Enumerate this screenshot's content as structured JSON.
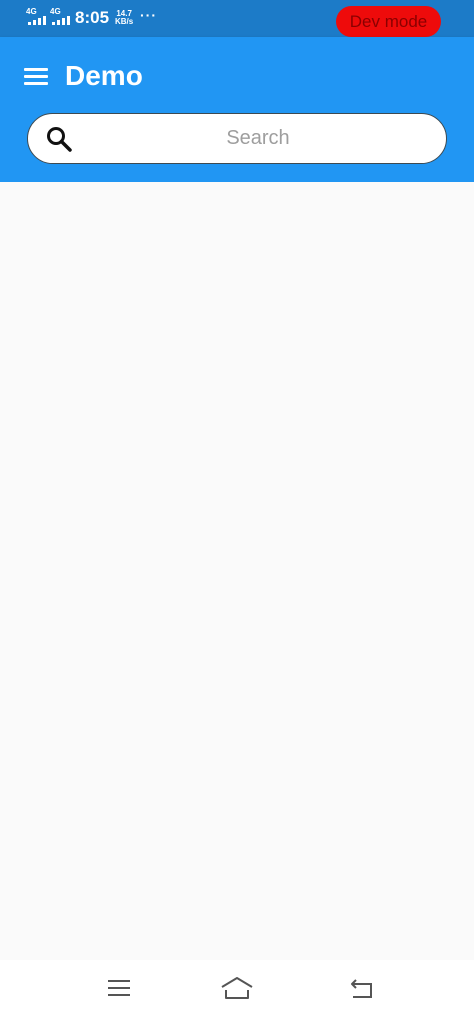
{
  "status_bar": {
    "network_1": "4G",
    "network_2": "4G",
    "time": "8:05",
    "speed_value": "14.7",
    "speed_unit": "KB/s",
    "more": "···",
    "dev_mode_label": "Dev mode",
    "dev_mode_color": "#ee0b0b"
  },
  "app_bar": {
    "title": "Demo",
    "color": "#2196f3",
    "menu_icon": "menu-icon"
  },
  "search": {
    "placeholder": "Search",
    "value": "",
    "icon": "search-icon"
  },
  "nav_bar": {
    "icons": [
      "recent-apps-icon",
      "home-icon",
      "back-icon"
    ]
  }
}
